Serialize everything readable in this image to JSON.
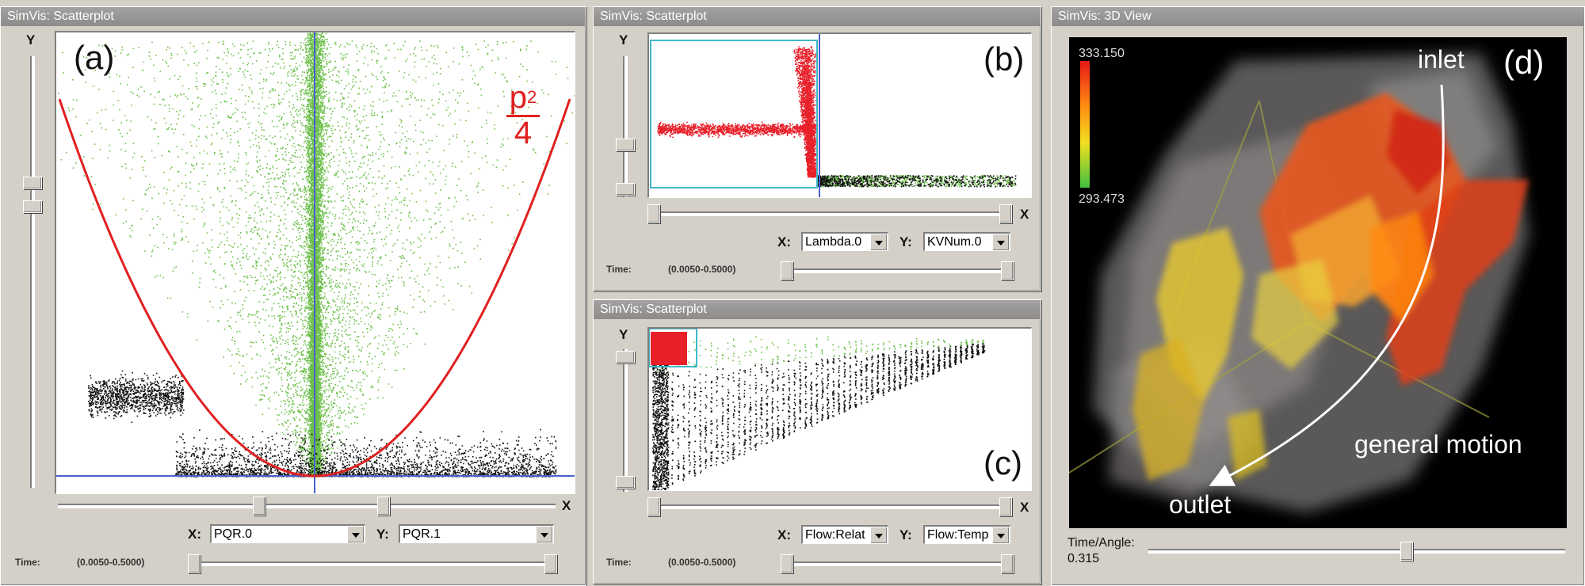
{
  "panel_a": {
    "title": "SimVis: Scatterplot",
    "letter": "(a)",
    "y_axis": "Y",
    "x_axis": "X",
    "annotation_p": "p",
    "annotation_exp": "2",
    "annotation_den": "4",
    "x_label": "X:",
    "x_value": "PQR.0",
    "y_label": "Y:",
    "y_value": "PQR.1",
    "time_label": "Time:",
    "time_range": "(0.0050-0.5000)"
  },
  "panel_b": {
    "title": "SimVis: Scatterplot",
    "letter": "(b)",
    "y_axis": "Y",
    "x_axis": "X",
    "x_label": "X:",
    "x_value": "Lambda.0",
    "y_label": "Y:",
    "y_value": "KVNum.0",
    "time_label": "Time:",
    "time_range": "(0.0050-0.5000)"
  },
  "panel_c": {
    "title": "SimVis: Scatterplot",
    "letter": "(c)",
    "y_axis": "Y",
    "x_axis": "X",
    "x_label": "X:",
    "x_value": "Flow:Relat",
    "y_label": "Y:",
    "y_value": "Flow:Temp",
    "time_label": "Time:",
    "time_range": "(0.0050-0.5000)"
  },
  "panel_d": {
    "title": "SimVis: 3D View",
    "letter": "(d)",
    "color_max": "333.150",
    "color_min": "293.473",
    "label_inlet": "inlet",
    "label_outlet": "outlet",
    "label_motion": "general motion",
    "time_angle_label": "Time/Angle:",
    "time_angle_value": "0.315"
  },
  "colors": {
    "focus_green": "#6cc04a",
    "context_black": "#111111",
    "brush_red": "#e8202a",
    "curve_red": "#e02020",
    "axis_blue": "#4a5fd0"
  }
}
